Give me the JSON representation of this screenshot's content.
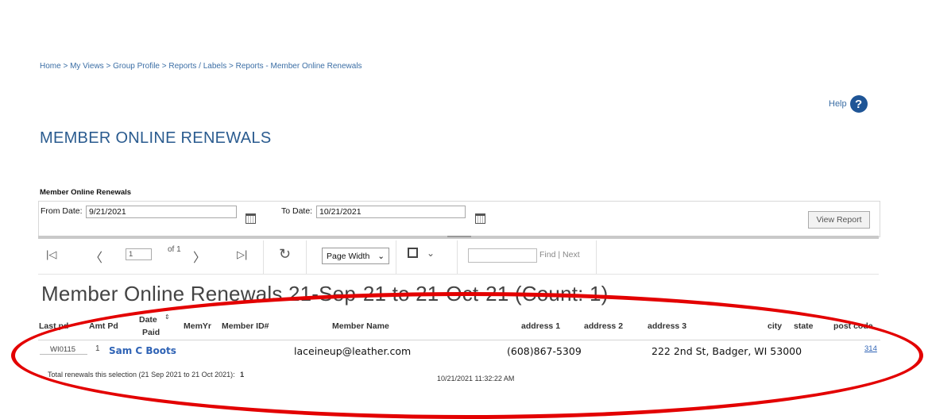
{
  "breadcrumb": "Home > My Views > Group Profile > Reports / Labels > Reports - Member Online Renewals",
  "help": {
    "label": "Help",
    "icon_glyph": "?"
  },
  "page_title": "MEMBER ONLINE RENEWALS",
  "params": {
    "section_label": "Member Online Renewals",
    "from_label": "From Date:",
    "from_value": "9/21/2021",
    "to_label": "To Date:",
    "to_value": "10/21/2021",
    "view_report": "View Report"
  },
  "toolbar": {
    "first_glyph": "|◁",
    "prev_glyph": "〈",
    "page_value": "1",
    "of_label": "of 1",
    "next_glyph": "〉",
    "last_glyph": "▷|",
    "refresh_glyph": "↻",
    "zoom_value": "Page Width",
    "save_glyph": "💾",
    "find_label": "Find",
    "find_sep": "|",
    "next_label": "Next"
  },
  "report": {
    "title": "Member Online Renewals    21-Sep-21 to 21-Oct-21  (Count: 1)",
    "columns": {
      "last_pd": "Last pd",
      "amt_pd": "Amt Pd",
      "date_paid_1": "Date",
      "date_paid_2": "Paid",
      "memyr": "MemYr",
      "member_id": "Member ID#",
      "member_name": "Member Name",
      "address1": "address 1",
      "address2": "address 2",
      "address3": "address 3",
      "city": "city",
      "state": "state",
      "post_code": "post code"
    },
    "row": {
      "code": "WI0115",
      "amt_frag": "1",
      "name": "Sam C Boots",
      "email": "laceineup@leather.com",
      "phone": "(608)867-5309",
      "address": "222 2nd St, Badger, WI 53000",
      "post_frag": "314"
    },
    "footer_total": "Total renewals this selection (21 Sep 2021 to 21 Oct 2021):",
    "footer_count": "1",
    "footer_timestamp": "10/21/2021 11:32:22 AM"
  },
  "colors": {
    "accent": "#2a5b8f",
    "link": "#3b6ea5",
    "highlight": "#e30000",
    "help_bg": "#1f5596"
  },
  "icons": [
    "help-icon",
    "calendar-icon",
    "first-page-icon",
    "prev-page-icon",
    "next-page-icon",
    "last-page-icon",
    "refresh-icon",
    "save-icon",
    "chevron-down-icon",
    "sort-icon"
  ]
}
